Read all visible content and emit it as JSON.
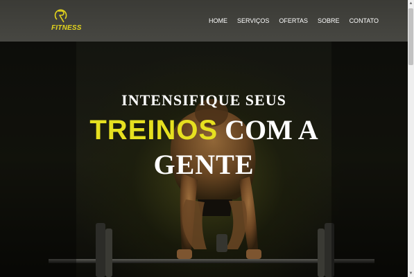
{
  "brand": {
    "logo_text": "FITNESS",
    "accent_color": "#e6e020"
  },
  "nav": {
    "items": [
      "HOME",
      "SERVIÇOS",
      "OFERTAS",
      "SOBRE",
      "CONTATO"
    ]
  },
  "hero": {
    "line1": "INTENSIFIQUE SEUS",
    "line2_accent": "TREINOS",
    "line2_rest": "COM A",
    "line3": "GENTE"
  },
  "icons": {
    "logo": "fitness-logo-icon",
    "scroll_up": "arrow-up-icon",
    "scroll_down": "arrow-down-icon"
  }
}
